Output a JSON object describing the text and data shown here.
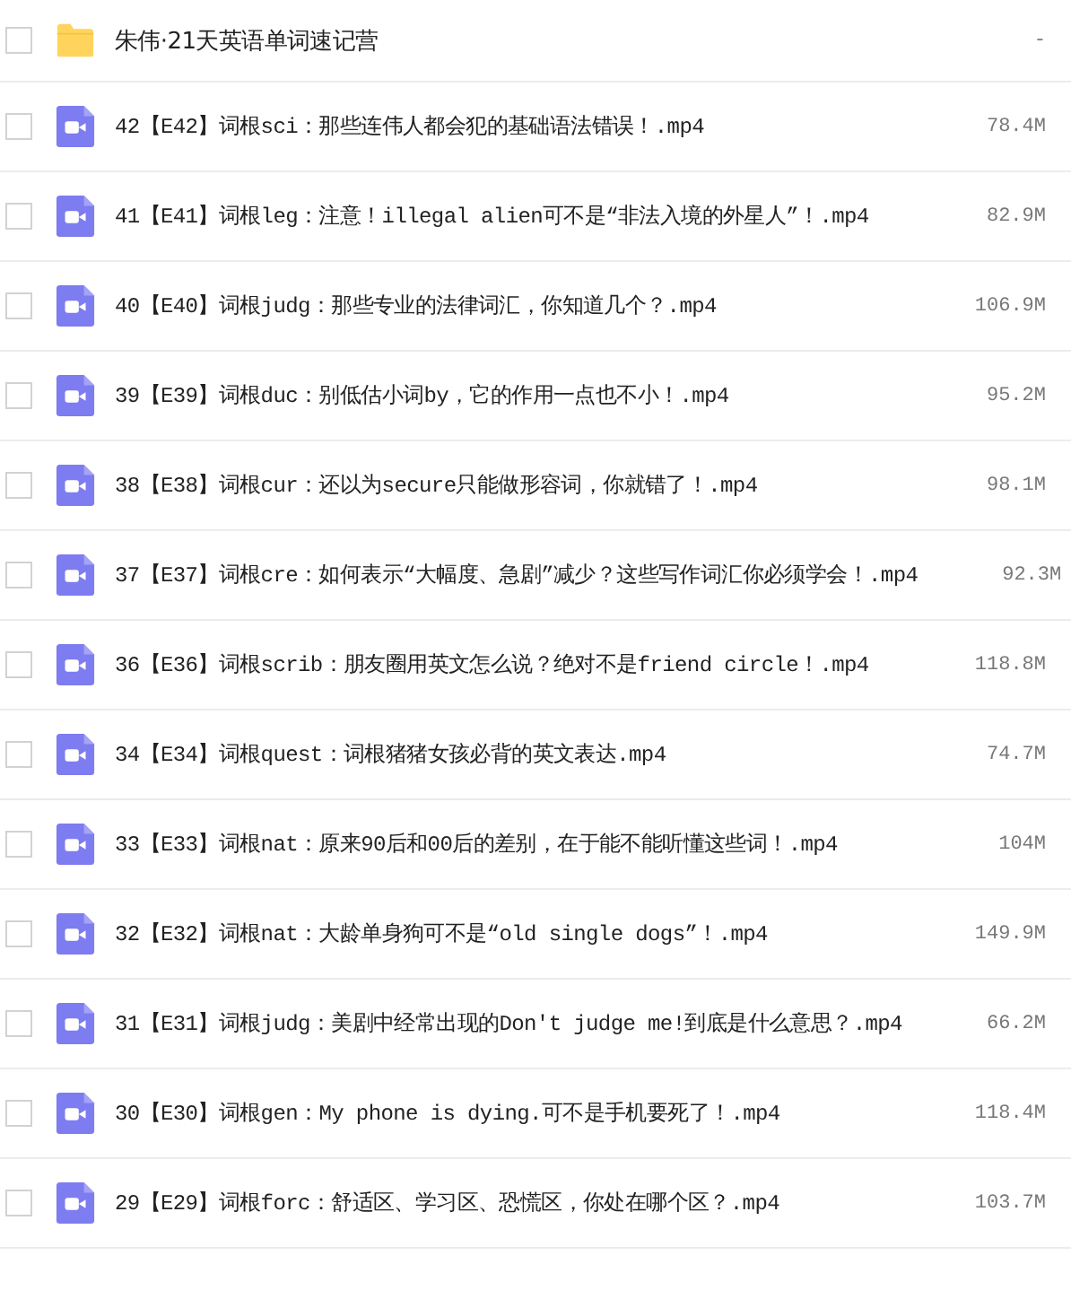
{
  "files": [
    {
      "kind": "folder",
      "name": "朱伟·21天英语单词速记营",
      "size": "-",
      "checked": false
    },
    {
      "kind": "video",
      "name": "42【E42】词根sci：那些连伟人都会犯的基础语法错误！.mp4",
      "size": "78.4M",
      "checked": false
    },
    {
      "kind": "video",
      "name": "41【E41】词根leg：注意！illegal alien可不是“非法入境的外星人”！.mp4",
      "size": "82.9M",
      "checked": false
    },
    {
      "kind": "video",
      "name": "40【E40】词根judg：那些专业的法律词汇，你知道几个？.mp4",
      "size": "106.9M",
      "checked": false
    },
    {
      "kind": "video",
      "name": "39【E39】词根duc：别低估小词by，它的作用一点也不小！.mp4",
      "size": "95.2M",
      "checked": false
    },
    {
      "kind": "video",
      "name": "38【E38】词根cur：还以为secure只能做形容词，你就错了！.mp4",
      "size": "98.1M",
      "checked": false
    },
    {
      "kind": "video",
      "name": "37【E37】词根cre：如何表示“大幅度、急剧”减少？这些写作词汇你必须学会！.mp4",
      "size": "92.3M",
      "checked": false
    },
    {
      "kind": "video",
      "name": "36【E36】词根scrib：朋友圈用英文怎么说？绝对不是friend circle！.mp4",
      "size": "118.8M",
      "checked": false
    },
    {
      "kind": "video",
      "name": "34【E34】词根quest：词根猪猪女孩必背的英文表达.mp4",
      "size": "74.7M",
      "checked": false
    },
    {
      "kind": "video",
      "name": "33【E33】词根nat：原来90后和00后的差别，在于能不能听懂这些词！.mp4",
      "size": "104M",
      "checked": false
    },
    {
      "kind": "video",
      "name": "32【E32】词根nat：大龄单身狗可不是“old single dogs”！.mp4",
      "size": "149.9M",
      "checked": false
    },
    {
      "kind": "video",
      "name": "31【E31】词根judg：美剧中经常出现的Don't judge me!到底是什么意思？.mp4",
      "size": "66.2M",
      "checked": false
    },
    {
      "kind": "video",
      "name": "30【E30】词根gen：My phone is dying.可不是手机要死了！.mp4",
      "size": "118.4M",
      "checked": false
    },
    {
      "kind": "video",
      "name": "29【E29】词根forc：舒适区、学习区、恐慌区，你处在哪个区？.mp4",
      "size": "103.7M",
      "checked": false
    }
  ]
}
